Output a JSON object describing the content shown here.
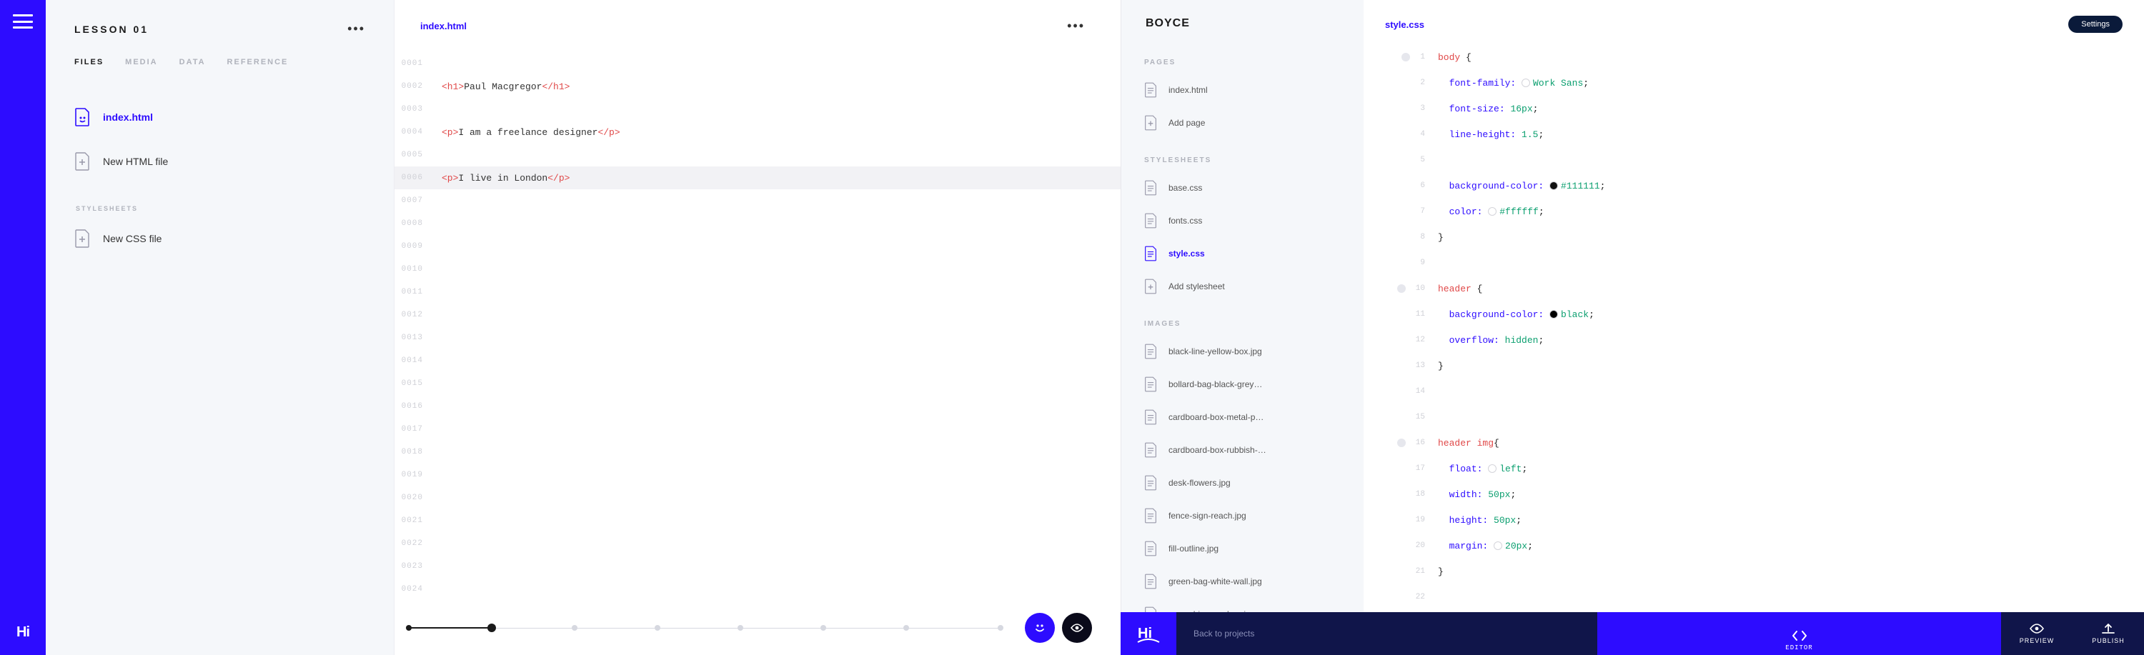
{
  "left": {
    "rail": {
      "logo": "Hi"
    },
    "lesson_title": "LESSON 01",
    "tabs": [
      "FILES",
      "MEDIA",
      "DATA",
      "REFERENCE"
    ],
    "files": {
      "items": [
        {
          "label": "index.html",
          "active": true
        },
        {
          "label": "New HTML file",
          "active": false
        }
      ]
    },
    "stylesheets_label": "STYLESHEETS",
    "stylesheets": [
      {
        "label": "New CSS file"
      }
    ],
    "editor": {
      "filename": "index.html",
      "lines": [
        {
          "n": "0001",
          "tag": "",
          "text": ""
        },
        {
          "n": "0002",
          "tag": "h1",
          "text": "Paul Macgregor"
        },
        {
          "n": "0003",
          "tag": "",
          "text": ""
        },
        {
          "n": "0004",
          "tag": "p",
          "text": "I am a freelance designer"
        },
        {
          "n": "0005",
          "tag": "",
          "text": ""
        },
        {
          "n": "0006",
          "tag": "p",
          "text": "I live in London",
          "hl": true
        },
        {
          "n": "0007",
          "tag": "",
          "text": ""
        },
        {
          "n": "0008",
          "tag": "",
          "text": ""
        },
        {
          "n": "0009",
          "tag": "",
          "text": ""
        },
        {
          "n": "0010",
          "tag": "",
          "text": ""
        },
        {
          "n": "0011",
          "tag": "",
          "text": ""
        },
        {
          "n": "0012",
          "tag": "",
          "text": ""
        },
        {
          "n": "0013",
          "tag": "",
          "text": ""
        },
        {
          "n": "0014",
          "tag": "",
          "text": ""
        },
        {
          "n": "0015",
          "tag": "",
          "text": ""
        },
        {
          "n": "0016",
          "tag": "",
          "text": ""
        },
        {
          "n": "0017",
          "tag": "",
          "text": ""
        },
        {
          "n": "0018",
          "tag": "",
          "text": ""
        },
        {
          "n": "0019",
          "tag": "",
          "text": ""
        },
        {
          "n": "0020",
          "tag": "",
          "text": ""
        },
        {
          "n": "0021",
          "tag": "",
          "text": ""
        },
        {
          "n": "0022",
          "tag": "",
          "text": ""
        },
        {
          "n": "0023",
          "tag": "",
          "text": ""
        },
        {
          "n": "0024",
          "tag": "",
          "text": ""
        }
      ]
    }
  },
  "right": {
    "project_title": "BOYCE",
    "settings_label": "Settings",
    "sections": {
      "pages_label": "PAGES",
      "pages": [
        {
          "label": "index.html"
        },
        {
          "label": "Add page"
        }
      ],
      "stylesheets_label": "STYLESHEETS",
      "stylesheets": [
        {
          "label": "base.css"
        },
        {
          "label": "fonts.css"
        },
        {
          "label": "style.css",
          "active": true
        },
        {
          "label": "Add stylesheet"
        }
      ],
      "images_label": "IMAGES",
      "images": [
        {
          "label": "black-line-yellow-box.jpg"
        },
        {
          "label": "bollard-bag-black-grey…"
        },
        {
          "label": "cardboard-box-metal-p…"
        },
        {
          "label": "cardboard-box-rubbish-…"
        },
        {
          "label": "desk-flowers.jpg"
        },
        {
          "label": "fence-sign-reach.jpg"
        },
        {
          "label": "fill-outline.jpg"
        },
        {
          "label": "green-bag-white-wall.jpg"
        },
        {
          "label": "green-bin-grey-bag.jpg"
        }
      ]
    },
    "editor": {
      "filename": "style.css",
      "lines": [
        {
          "n": "1",
          "fold": true,
          "sel": "body",
          "open": true
        },
        {
          "n": "2",
          "prop": "font-family",
          "val": "Work Sans",
          "pill": true,
          "semi": true
        },
        {
          "n": "3",
          "prop": "font-size",
          "val": "16px",
          "semi": true
        },
        {
          "n": "4",
          "prop": "line-height",
          "val": "1.5",
          "semi": true
        },
        {
          "n": "5"
        },
        {
          "n": "6",
          "prop": "background-color",
          "val": "#111111",
          "swatch": "#111111",
          "semi": true
        },
        {
          "n": "7",
          "prop": "color",
          "val": "#ffffff",
          "swatch": "#ffffff",
          "semi": true
        },
        {
          "n": "8",
          "close": true
        },
        {
          "n": "9"
        },
        {
          "n": "10",
          "fold": true,
          "sel": "header",
          "open": true
        },
        {
          "n": "11",
          "prop": "background-color",
          "val": "black",
          "swatch": "#000000",
          "semi": true
        },
        {
          "n": "12",
          "prop": "overflow",
          "val": "hidden",
          "semi": true
        },
        {
          "n": "13",
          "close": true
        },
        {
          "n": "14"
        },
        {
          "n": "15"
        },
        {
          "n": "16",
          "fold": true,
          "sel": "header img",
          "open": true,
          "tight": true
        },
        {
          "n": "17",
          "prop": "float",
          "val": "left",
          "pill": true,
          "semi": true
        },
        {
          "n": "18",
          "prop": "width",
          "val": "50px",
          "semi": true
        },
        {
          "n": "19",
          "prop": "height",
          "val": "50px",
          "semi": true
        },
        {
          "n": "20",
          "prop": "margin",
          "val": "20px",
          "pill": true,
          "semi": true
        },
        {
          "n": "21",
          "close": true
        },
        {
          "n": "22"
        }
      ]
    },
    "footer": {
      "logo": "Hi",
      "back_label": "Back to projects",
      "editor_label": "EDITOR",
      "preview_label": "PREVIEW",
      "publish_label": "PUBLISH"
    }
  }
}
